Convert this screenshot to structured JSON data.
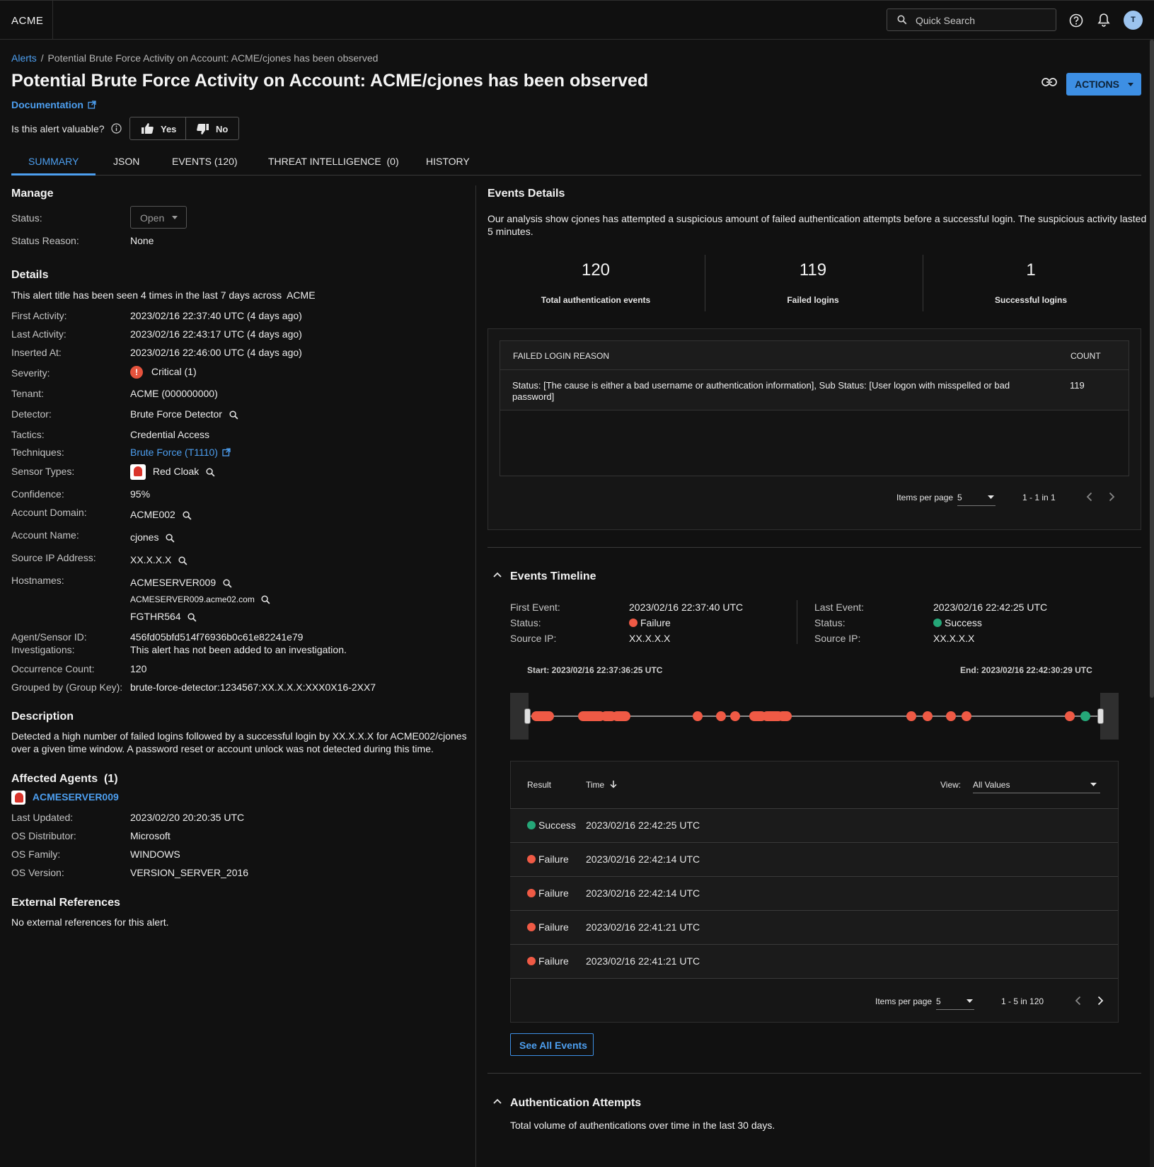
{
  "app": {
    "logo": "ACME",
    "search_placeholder": "Quick Search",
    "avatar_initial": "T"
  },
  "breadcrumb": {
    "root": "Alerts",
    "separator": "/",
    "current": "Potential Brute Force Activity on Account: ACME/cjones has been observed"
  },
  "header": {
    "title": "Potential Brute Force Activity on Account: ACME/cjones has been observed",
    "documentation": "Documentation",
    "actions_label": "ACTIONS",
    "valuable_question": "Is this alert valuable?",
    "yes_label": "Yes",
    "no_label": "No"
  },
  "tabs": [
    {
      "label": "SUMMARY",
      "active": true
    },
    {
      "label": "JSON"
    },
    {
      "label": "EVENTS (120)"
    },
    {
      "label": "THREAT INTELLIGENCE  (0)"
    },
    {
      "label": "HISTORY"
    }
  ],
  "manage": {
    "title": "Manage",
    "status_label": "Status:",
    "status_value": "Open",
    "reason_label": "Status Reason:",
    "reason_value": "None"
  },
  "details": {
    "title": "Details",
    "seen_text": "This alert title has been seen 4 times in the last 7 days across  ACME",
    "rows": [
      {
        "label": "First Activity:",
        "value": "2023/02/16 22:37:40 UTC (4 days ago)"
      },
      {
        "label": "Last Activity:",
        "value": "2023/02/16 22:43:17 UTC (4 days ago)"
      },
      {
        "label": "Inserted At:",
        "value": "2023/02/16 22:46:00 UTC (4 days ago)"
      },
      {
        "label": "Severity:",
        "value": "Critical (1)"
      },
      {
        "label": "Tenant:",
        "value": "ACME (000000000)"
      },
      {
        "label": "Detector:",
        "value": "Brute Force Detector"
      },
      {
        "label": "Tactics:",
        "value": "Credential Access"
      },
      {
        "label": "Techniques:",
        "value": "Brute Force (T1110)"
      },
      {
        "label": "Sensor Types:",
        "value": "Red Cloak"
      },
      {
        "label": "Confidence:",
        "value": "95%"
      },
      {
        "label": "Account Domain:",
        "value": "ACME002"
      },
      {
        "label": "Account Name:",
        "value": "cjones"
      },
      {
        "label": "Source IP Address:",
        "value": "XX.X.X.X"
      },
      {
        "label": "Hostnames:",
        "values": [
          "ACMESERVER009",
          "ACMESERVER009.acme02.com",
          "FGTHR564"
        ]
      },
      {
        "label": "Agent/Sensor ID:",
        "value": "456fd05bfd514f76936b0c61e82241e79"
      },
      {
        "label": "Investigations:",
        "value": "This alert has not been added to an investigation."
      },
      {
        "label": "Occurrence Count:",
        "value": "120"
      },
      {
        "label": "Grouped by (Group Key):",
        "value": "brute-force-detector:1234567:XX.X.X.X:XXX0X16-2XX7"
      }
    ]
  },
  "description": {
    "title": "Description",
    "line1": "Detected a high number of failed logins followed by a successful login by XX.X.X.X for ACME002/cjones",
    "line2": "over a given time window. A password reset or account unlock was not detected during this time."
  },
  "affected_agents": {
    "title": "Affected Agents  (1)",
    "agent_name": "ACMESERVER009",
    "rows": [
      {
        "label": "Last Updated:",
        "value": "2023/02/20 20:20:35 UTC"
      },
      {
        "label": "OS Distributor:",
        "value": "Microsoft"
      },
      {
        "label": "OS Family:",
        "value": "WINDOWS"
      },
      {
        "label": "OS Version:",
        "value": "VERSION_SERVER_2016"
      }
    ]
  },
  "external_refs": {
    "title": "External References",
    "text": "No external references for this alert."
  },
  "events_details": {
    "title": "Events Details",
    "summary_line1": "Our analysis show cjones has attempted a suspicious amount of failed authentication attempts before a successful login. The suspicious activity lasted",
    "summary_line2": "5 minutes.",
    "stats": [
      {
        "value": "120",
        "label": "Total authentication events"
      },
      {
        "value": "119",
        "label": "Failed logins"
      },
      {
        "value": "1",
        "label": "Successful logins"
      }
    ],
    "reason_table": {
      "col_reason": "FAILED LOGIN REASON",
      "col_count": "COUNT",
      "row_reason_line1": "Status: [The cause is either a bad username or authentication information], Sub Status: [User logon with misspelled or bad",
      "row_reason_line2": "password]",
      "row_count": "119",
      "items_per_page_label": "Items per page",
      "items_per_page": "5",
      "range": "1 - 1 in 1"
    }
  },
  "timeline": {
    "title": "Events Timeline",
    "first_event_label": "First Event:",
    "first_event": "2023/02/16 22:37:40 UTC",
    "first_status_label": "Status:",
    "first_status": "Failure",
    "first_ip_label": "Source IP:",
    "first_ip": "XX.X.X.X",
    "last_event_label": "Last Event:",
    "last_event": "2023/02/16 22:42:25 UTC",
    "last_status_label": "Status:",
    "last_status": "Success",
    "last_ip_label": "Source IP:",
    "last_ip": "XX.X.X.X",
    "start_label": "Start: 2023/02/16 22:37:36:25 UTC",
    "end_label": "End: 2023/02/16 22:42:30:29 UTC",
    "colors": {
      "failure": "#ef5a45",
      "success": "#25a778"
    },
    "table": {
      "col_result": "Result",
      "col_time": "Time",
      "view_label": "View:",
      "view_value": "All Values",
      "rows": [
        {
          "result": "Success",
          "time": "2023/02/16 22:42:25 UTC"
        },
        {
          "result": "Failure",
          "time": "2023/02/16 22:42:14 UTC"
        },
        {
          "result": "Failure",
          "time": "2023/02/16 22:42:14 UTC"
        },
        {
          "result": "Failure",
          "time": "2023/02/16 22:41:21 UTC"
        },
        {
          "result": "Failure",
          "time": "2023/02/16 22:41:21 UTC"
        }
      ],
      "items_per_page_label": "Items per page",
      "items_per_page": "5",
      "range": "1 - 5 in 120"
    },
    "see_all": "See All Events"
  },
  "auth_attempts": {
    "title": "Authentication Attempts",
    "subtitle": "Total volume of authentications over time in the last 30 days."
  }
}
